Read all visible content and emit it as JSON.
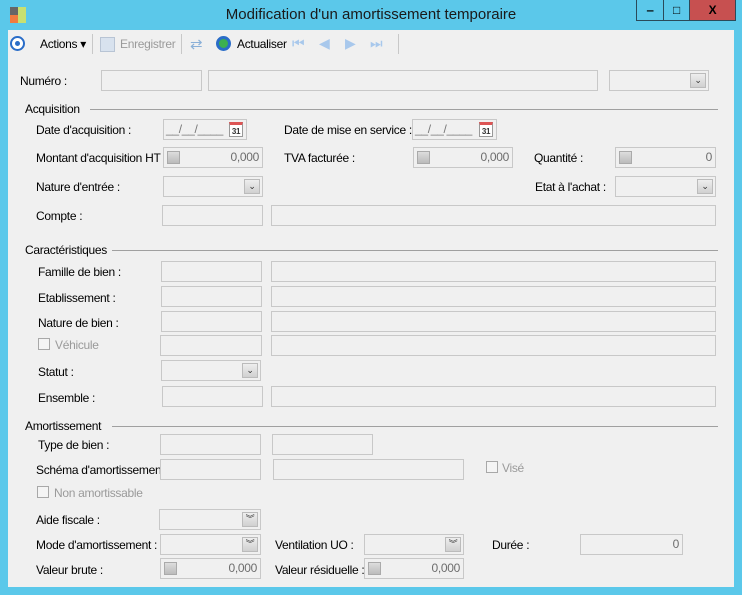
{
  "window": {
    "title": "Modification d'un amortissement temporaire",
    "minimize": "‒",
    "maximize": "□",
    "close": "X",
    "close_color": "#c75050"
  },
  "toolbar": {
    "actions": "Actions",
    "enregistrer": "Enregistrer",
    "actualiser": "Actualiser"
  },
  "numero": {
    "label": "Numéro :"
  },
  "acquisition": {
    "title": "Acquisition",
    "date_acq": "Date d'acquisition :",
    "date_acq_value": "__/__/____",
    "date_service": "Date de mise  en service :",
    "date_service_value": "__/__/____",
    "calendar": "31",
    "montant": "Montant d'acquisition HT :",
    "montant_value": "0,000",
    "tva": "TVA facturée :",
    "tva_value": "0,000",
    "quantite": "Quantité :",
    "quantite_value": "0",
    "nature": "Nature d'entrée :",
    "etat": "Etat à l'achat :",
    "compte": "Compte :"
  },
  "caracteristiques": {
    "title": "Caractéristiques",
    "famille": "Famille de bien :",
    "etablissement": "Etablissement :",
    "nature": "Nature de bien :",
    "vehicule": "Véhicule",
    "statut": "Statut :",
    "ensemble": "Ensemble :"
  },
  "amortissement": {
    "title": "Amortissement",
    "type": "Type de bien :",
    "schema": "Schéma d'amortissement :",
    "vise": "Visé",
    "non_amort": "Non amortissable",
    "aide": "Aide fiscale :",
    "mode": "Mode d'amortissement :",
    "ventilation": "Ventilation UO :",
    "duree": "Durée :",
    "duree_value": "0",
    "valeur_brute": "Valeur brute :",
    "valeur_brute_value": "0,000",
    "valeur_res": "Valeur résiduelle :",
    "valeur_res_value": "0,000"
  }
}
